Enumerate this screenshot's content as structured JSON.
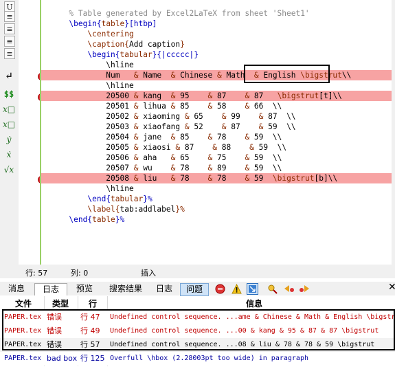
{
  "toolbar": {
    "items": [
      {
        "glyph": "U",
        "icon": "underline-icon"
      },
      {
        "glyph": "≡",
        "icon": "align-left-icon"
      },
      {
        "glyph": "≡",
        "icon": "align-center-icon"
      },
      {
        "glyph": "≡",
        "icon": "align-right-icon"
      },
      {
        "glyph": "≡",
        "icon": "align-justify-icon"
      },
      {
        "glyph": "↵",
        "icon": "newline-icon"
      },
      {
        "glyph": "$$",
        "icon": "display-math-icon"
      },
      {
        "glyph": "x□",
        "icon": "subscript-icon"
      },
      {
        "glyph": "x□",
        "icon": "superscript-icon"
      },
      {
        "glyph": "ẏ",
        "icon": "dot-accent-icon"
      },
      {
        "glyph": "ẋ",
        "icon": "vector-icon"
      },
      {
        "glyph": "√x",
        "icon": "sqrt-icon"
      }
    ]
  },
  "editor": {
    "lines": [
      {
        "indent": "",
        "parts": [
          {
            "t": "% Table generated by Excel2LaTeX from sheet 'Sheet1'",
            "c": "comment"
          }
        ]
      },
      {
        "indent": "",
        "parts": [
          {
            "t": "\\begin{",
            "c": "kw"
          },
          {
            "t": "table",
            "c": "cmd"
          },
          {
            "t": "}[htbp]",
            "c": "kw"
          }
        ]
      },
      {
        "indent": "    ",
        "parts": [
          {
            "t": "\\centering",
            "c": "cmd"
          }
        ]
      },
      {
        "indent": "    ",
        "parts": [
          {
            "t": "\\caption{",
            "c": "cmd"
          },
          {
            "t": "Add caption",
            "c": ""
          },
          {
            "t": "}",
            "c": "cmd"
          }
        ]
      },
      {
        "indent": "    ",
        "parts": [
          {
            "t": "\\begin{",
            "c": "kw"
          },
          {
            "t": "tabular",
            "c": "cmd"
          },
          {
            "t": "}{|ccccc|}",
            "c": "kw"
          }
        ]
      },
      {
        "indent": "        ",
        "parts": [
          {
            "t": "\\hline",
            "c": ""
          }
        ]
      },
      {
        "indent": "        ",
        "err": true,
        "parts": [
          {
            "t": "Num   ",
            "c": ""
          },
          {
            "t": "&",
            "c": "cmd"
          },
          {
            "t": " Name  ",
            "c": ""
          },
          {
            "t": "&",
            "c": "cmd"
          },
          {
            "t": " Chinese ",
            "c": ""
          },
          {
            "t": "&",
            "c": "cmd"
          },
          {
            "t": " Math  ",
            "c": ""
          },
          {
            "t": "&",
            "c": "cmd"
          },
          {
            "t": " English ",
            "c": ""
          },
          {
            "t": "\\bigstrut",
            "c": "cmd"
          },
          {
            "t": "\\\\",
            "c": ""
          }
        ]
      },
      {
        "indent": "        ",
        "parts": [
          {
            "t": "\\hline",
            "c": ""
          }
        ]
      },
      {
        "indent": "        ",
        "err": true,
        "parts": [
          {
            "t": "20500 ",
            "c": ""
          },
          {
            "t": "&",
            "c": "cmd"
          },
          {
            "t": " kang  ",
            "c": ""
          },
          {
            "t": "&",
            "c": "cmd"
          },
          {
            "t": " 95    ",
            "c": ""
          },
          {
            "t": "&",
            "c": "cmd"
          },
          {
            "t": " 87    ",
            "c": ""
          },
          {
            "t": "&",
            "c": "cmd"
          },
          {
            "t": " 87   ",
            "c": ""
          },
          {
            "t": "\\bigstrut",
            "c": "cmd"
          },
          {
            "t": "[t]\\\\",
            "c": ""
          }
        ]
      },
      {
        "indent": "        ",
        "parts": [
          {
            "t": "20501 ",
            "c": ""
          },
          {
            "t": "&",
            "c": "cmd"
          },
          {
            "t": " lihua ",
            "c": ""
          },
          {
            "t": "&",
            "c": "cmd"
          },
          {
            "t": " 85    ",
            "c": ""
          },
          {
            "t": "&",
            "c": "cmd"
          },
          {
            "t": " 58    ",
            "c": ""
          },
          {
            "t": "&",
            "c": "cmd"
          },
          {
            "t": " 66  \\\\",
            "c": ""
          }
        ]
      },
      {
        "indent": "        ",
        "parts": [
          {
            "t": "20502 ",
            "c": ""
          },
          {
            "t": "&",
            "c": "cmd"
          },
          {
            "t": " xiaoming ",
            "c": ""
          },
          {
            "t": "&",
            "c": "cmd"
          },
          {
            "t": " 65    ",
            "c": ""
          },
          {
            "t": "&",
            "c": "cmd"
          },
          {
            "t": " 99    ",
            "c": ""
          },
          {
            "t": "&",
            "c": "cmd"
          },
          {
            "t": " 87  \\\\",
            "c": ""
          }
        ]
      },
      {
        "indent": "        ",
        "parts": [
          {
            "t": "20503 ",
            "c": ""
          },
          {
            "t": "&",
            "c": "cmd"
          },
          {
            "t": " xiaofang ",
            "c": ""
          },
          {
            "t": "&",
            "c": "cmd"
          },
          {
            "t": " 52    ",
            "c": ""
          },
          {
            "t": "&",
            "c": "cmd"
          },
          {
            "t": " 87    ",
            "c": ""
          },
          {
            "t": "&",
            "c": "cmd"
          },
          {
            "t": " 59  \\\\",
            "c": ""
          }
        ]
      },
      {
        "indent": "        ",
        "parts": [
          {
            "t": "20504 ",
            "c": ""
          },
          {
            "t": "&",
            "c": "cmd"
          },
          {
            "t": " jane  ",
            "c": ""
          },
          {
            "t": "&",
            "c": "cmd"
          },
          {
            "t": " 85    ",
            "c": ""
          },
          {
            "t": "&",
            "c": "cmd"
          },
          {
            "t": " 78    ",
            "c": ""
          },
          {
            "t": "&",
            "c": "cmd"
          },
          {
            "t": " 59  \\\\",
            "c": ""
          }
        ]
      },
      {
        "indent": "        ",
        "parts": [
          {
            "t": "20505 ",
            "c": ""
          },
          {
            "t": "&",
            "c": "cmd"
          },
          {
            "t": " xiaosi ",
            "c": ""
          },
          {
            "t": "&",
            "c": "cmd"
          },
          {
            "t": " 87    ",
            "c": ""
          },
          {
            "t": "&",
            "c": "cmd"
          },
          {
            "t": " 88    ",
            "c": ""
          },
          {
            "t": "&",
            "c": "cmd"
          },
          {
            "t": " 59  \\\\",
            "c": ""
          }
        ]
      },
      {
        "indent": "        ",
        "parts": [
          {
            "t": "20506 ",
            "c": ""
          },
          {
            "t": "&",
            "c": "cmd"
          },
          {
            "t": " aha   ",
            "c": ""
          },
          {
            "t": "&",
            "c": "cmd"
          },
          {
            "t": " 65    ",
            "c": ""
          },
          {
            "t": "&",
            "c": "cmd"
          },
          {
            "t": " 75    ",
            "c": ""
          },
          {
            "t": "&",
            "c": "cmd"
          },
          {
            "t": " 59  \\\\",
            "c": ""
          }
        ]
      },
      {
        "indent": "        ",
        "parts": [
          {
            "t": "20507 ",
            "c": ""
          },
          {
            "t": "&",
            "c": "cmd"
          },
          {
            "t": " wu    ",
            "c": ""
          },
          {
            "t": "&",
            "c": "cmd"
          },
          {
            "t": " 78    ",
            "c": ""
          },
          {
            "t": "&",
            "c": "cmd"
          },
          {
            "t": " 89    ",
            "c": ""
          },
          {
            "t": "&",
            "c": "cmd"
          },
          {
            "t": " 59  \\\\",
            "c": ""
          }
        ]
      },
      {
        "indent": "        ",
        "err": true,
        "parts": [
          {
            "t": "20508 ",
            "c": ""
          },
          {
            "t": "&",
            "c": "cmd"
          },
          {
            "t": " liu   ",
            "c": ""
          },
          {
            "t": "&",
            "c": "cmd"
          },
          {
            "t": " 78    ",
            "c": ""
          },
          {
            "t": "&",
            "c": "cmd"
          },
          {
            "t": " 78    ",
            "c": ""
          },
          {
            "t": "&",
            "c": "cmd"
          },
          {
            "t": " 59  ",
            "c": ""
          },
          {
            "t": "\\bigstrut",
            "c": "cmd"
          },
          {
            "t": "[b]\\\\",
            "c": ""
          }
        ]
      },
      {
        "indent": "        ",
        "parts": [
          {
            "t": "\\hline",
            "c": ""
          }
        ]
      },
      {
        "indent": "    ",
        "parts": [
          {
            "t": "\\end{",
            "c": "kw"
          },
          {
            "t": "tabular",
            "c": "cmd"
          },
          {
            "t": "}%",
            "c": "kw"
          }
        ]
      },
      {
        "indent": "    ",
        "parts": [
          {
            "t": "\\label{",
            "c": "cmd"
          },
          {
            "t": "tab:addlabel",
            "c": ""
          },
          {
            "t": "}%",
            "c": "cmd"
          }
        ]
      },
      {
        "indent": "",
        "parts": [
          {
            "t": "\\end{",
            "c": "kw"
          },
          {
            "t": "table",
            "c": "cmd"
          },
          {
            "t": "}%",
            "c": "kw"
          }
        ]
      }
    ]
  },
  "status": {
    "line_label": "行: 57",
    "col_label": "列: 0",
    "mode": "插入"
  },
  "tabs": [
    {
      "label": "消息",
      "name": "tab-messages"
    },
    {
      "label": "日志",
      "name": "tab-log",
      "active": true
    },
    {
      "label": "预览",
      "name": "tab-preview"
    },
    {
      "label": "搜索结果",
      "name": "tab-search-results"
    }
  ],
  "sub_tabs": [
    {
      "label": "日志",
      "name": "tab-log-view"
    },
    {
      "label": "问题",
      "name": "tab-problems",
      "selected": true
    }
  ],
  "log": {
    "headers": {
      "file": "文件",
      "type": "类型",
      "line": "行",
      "message": "信息"
    },
    "rows": [
      {
        "file": "PAPER.tex",
        "type": "错误",
        "line": "行 47",
        "message": "Undefined control sequence. ...ame & Chinese & Math & English \\bigstru",
        "level": "error"
      },
      {
        "file": "PAPER.tex",
        "type": "错误",
        "line": "行 49",
        "message": "Undefined control sequence. ...00 & kang & 95 & 87 & 87 \\bigstrut",
        "level": "error"
      },
      {
        "file": "PAPER.tex",
        "type": "错误",
        "line": "行 57",
        "message": "Undefined control sequence. ...08 & liu & 78 & 78 & 59 \\bigstrut",
        "level": "error-selected"
      },
      {
        "file": "PAPER.tex",
        "type": "bad box",
        "line": "行 125",
        "message": "Overfull \\hbox (2.28003pt too wide) in paragraph",
        "level": "badbox"
      }
    ]
  },
  "colors": {
    "error_line": "#f7a3a3",
    "error_text": "#c00000",
    "badbox_text": "#0000a0",
    "accent_bar": "#9ad066"
  }
}
